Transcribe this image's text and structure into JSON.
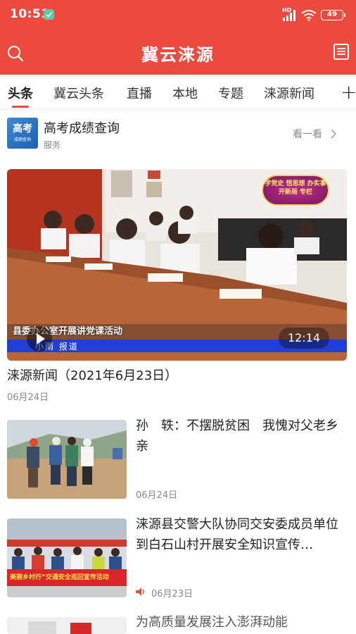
{
  "status_bar": {
    "time": "10:51",
    "network": "HD",
    "battery": "49"
  },
  "header": {
    "title": "冀云涞源"
  },
  "tabs": [
    {
      "label": "头条"
    },
    {
      "label": "冀云头条"
    },
    {
      "label": "直播"
    },
    {
      "label": "本地"
    },
    {
      "label": "专题"
    },
    {
      "label": "涞源新闻"
    }
  ],
  "service": {
    "logo_text": "高考",
    "logo_subtext": "成绩查询",
    "name": "高考成绩查询",
    "category": "服务",
    "more_label": "看一看"
  },
  "video_card": {
    "overlay_subtitle": "县委办公室开展讲党课活动",
    "reporter_line": "小雨  报道",
    "badge_text": "学党史 悟思想 办实事 开新局 专栏",
    "duration": "12:14",
    "title": "涞源新闻（2021年6月23日）",
    "date": "06月24日"
  },
  "news": [
    {
      "headline": "孙　轶：不摆脱贫困　我愧对父老乡亲",
      "date": "06月24日"
    },
    {
      "headline": "涞源县交警大队协同交安委成员单位到白石山村开展安全知识宣传…",
      "date": "06月23日",
      "banner_text": "美丽乡村行”交通安全巡回宣传活动",
      "has_audio": true
    },
    {
      "headline": "为高质量发展注入澎湃动能"
    }
  ],
  "colors": {
    "brand": "#ec4a3f",
    "text": "#222222",
    "muted": "#888888"
  }
}
